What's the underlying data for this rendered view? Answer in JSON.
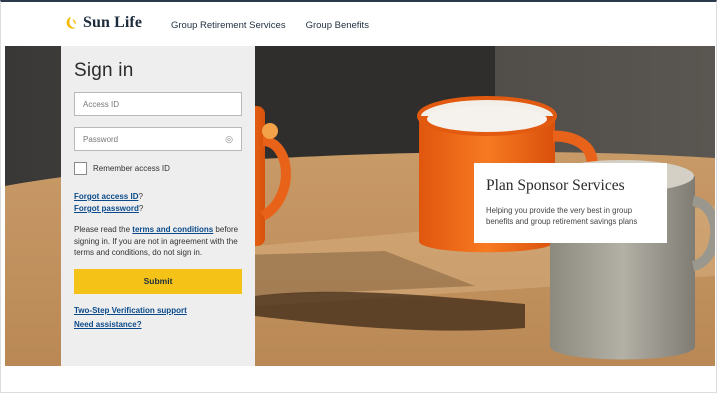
{
  "header": {
    "logo_text": "Sun Life",
    "nav": [
      "Group Retirement Services",
      "Group Benefits"
    ]
  },
  "signin": {
    "title": "Sign in",
    "access_id_placeholder": "Access ID",
    "password_placeholder": "Password",
    "remember_label": "Remember access ID",
    "forgot_id": "Forgot access ID",
    "forgot_password": "Forgot password",
    "notice_prefix": "Please read the",
    "notice_link": "terms and conditions",
    "notice_suffix": "before signing in. If you are not in agreement with the terms and conditions, do not sign in.",
    "submit_label": "Submit",
    "two_step_link": "Two-Step Verification support",
    "assistance_link": "Need assistance?"
  },
  "promo": {
    "title": "Plan Sponsor Services",
    "text": "Helping you provide the very best in group benefits and group retirement savings plans"
  },
  "colors": {
    "brand_yellow": "#f5c218",
    "brand_navy": "#1d2c3d",
    "link_blue": "#0a4a8a"
  },
  "icons": [
    "sun-logo-icon",
    "eye-icon"
  ]
}
